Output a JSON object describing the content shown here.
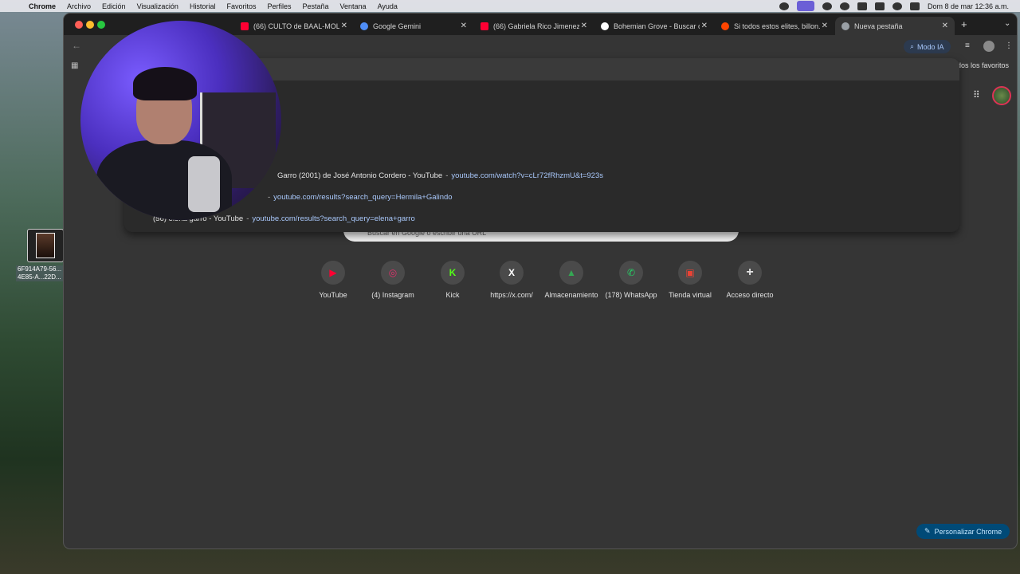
{
  "menubar": {
    "app_name": "Chrome",
    "menus": [
      "Archivo",
      "Edición",
      "Visualización",
      "Historial",
      "Favoritos",
      "Perfiles",
      "Pestaña",
      "Ventana",
      "Ayuda"
    ],
    "clock": "Dom 8 de mar  12:36 a.m."
  },
  "desktop": {
    "file_label": "6F914A79-56...\n4E85-A...22D..."
  },
  "tabs": [
    {
      "title": "(66) CULTO de BAAL-MOL...",
      "favicon": "youtube-icon",
      "color": "#ff0033"
    },
    {
      "title": "Google Gemini",
      "favicon": "gemini-icon",
      "color": "#4f8ef7"
    },
    {
      "title": "(66) Gabriela Rico Jimenez",
      "favicon": "youtube-icon",
      "color": "#ff0033"
    },
    {
      "title": "Bohemian Grove - Buscar c...",
      "favicon": "google-icon",
      "color": "#ffffff"
    },
    {
      "title": "Si todos estos elites, billon...",
      "favicon": "reddit-icon",
      "color": "#ff4500"
    },
    {
      "title": "Nueva pestaña",
      "favicon": "chrome-icon",
      "color": "#9aa0a6",
      "active": true
    }
  ],
  "toolbar": {
    "modo_ia": "Modo IA",
    "all_bookmarks": "odos los favoritos"
  },
  "omnibox": {
    "suggestions": [
      {
        "text": "Garro (2001) de José Antonio Cordero - YouTube",
        "url": "youtube.com/watch?v=cLr72fRhzmU&t=923s"
      },
      {
        "text": "",
        "url": "youtube.com/results?search_query=Hermila+Galindo"
      },
      {
        "text": "(56) elena garro - YouTube",
        "url": "youtube.com/results?search_query=elena+garro"
      }
    ]
  },
  "ntp": {
    "search_placeholder": "Buscar en Google o escribir una URL",
    "shortcuts": [
      {
        "label": "YouTube",
        "icon": "youtube-icon",
        "color": "#ff0033",
        "glyph": "▶"
      },
      {
        "label": "(4) Instagram",
        "icon": "instagram-icon",
        "color": "#e1306c",
        "glyph": "◎"
      },
      {
        "label": "Kick",
        "icon": "kick-icon",
        "color": "#53fc18",
        "glyph": "K"
      },
      {
        "label": "https://x.com/",
        "icon": "x-icon",
        "color": "#ffffff",
        "glyph": "𝕏"
      },
      {
        "label": "Almacenamiento",
        "icon": "google-drive-icon",
        "color": "#34a853",
        "glyph": "▲"
      },
      {
        "label": "(178) WhatsApp",
        "icon": "whatsapp-icon",
        "color": "#25d366",
        "glyph": "✆"
      },
      {
        "label": "Tienda virtual",
        "icon": "chrome-web-store-icon",
        "color": "#ea4335",
        "glyph": "▣"
      },
      {
        "label": "Acceso directo",
        "icon": "plus-icon",
        "color": "#e3e3e3",
        "glyph": "+"
      }
    ],
    "personalize": "Personalizar Chrome"
  }
}
